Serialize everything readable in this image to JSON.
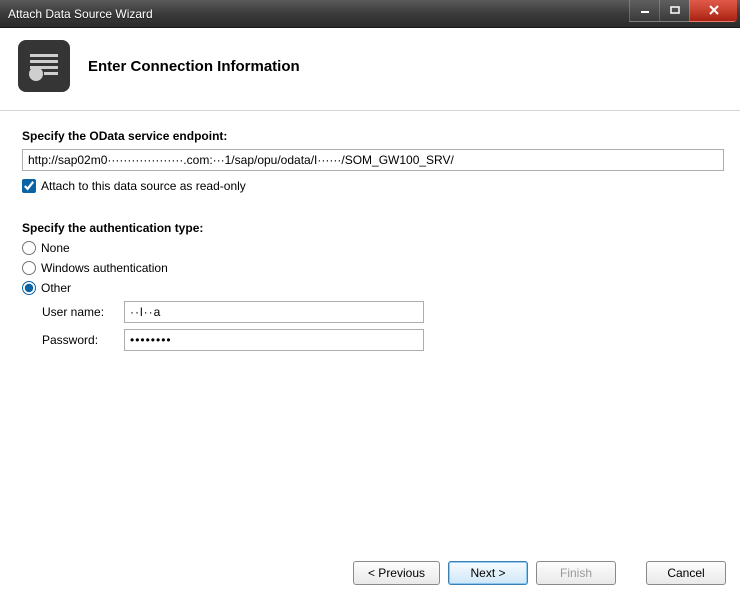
{
  "window": {
    "title": "Attach Data Source Wizard"
  },
  "header": {
    "title": "Enter Connection Information"
  },
  "endpoint": {
    "label": "Specify the OData service endpoint:",
    "value": "http://sap02m0···················.com:···1/sap/opu/odata/I······/SOM_GW100_SRV/"
  },
  "readonly": {
    "label": "Attach to this data source as read-only",
    "checked": true
  },
  "auth": {
    "label": "Specify the authentication type:",
    "options": {
      "none": "None",
      "windows": "Windows authentication",
      "other": "Other"
    },
    "selected": "other",
    "username_label": "User name:",
    "username_value": "··l··a",
    "password_label": "Password:",
    "password_placeholder": "••••••••"
  },
  "buttons": {
    "previous": "< Previous",
    "next": "Next >",
    "finish": "Finish",
    "cancel": "Cancel"
  }
}
